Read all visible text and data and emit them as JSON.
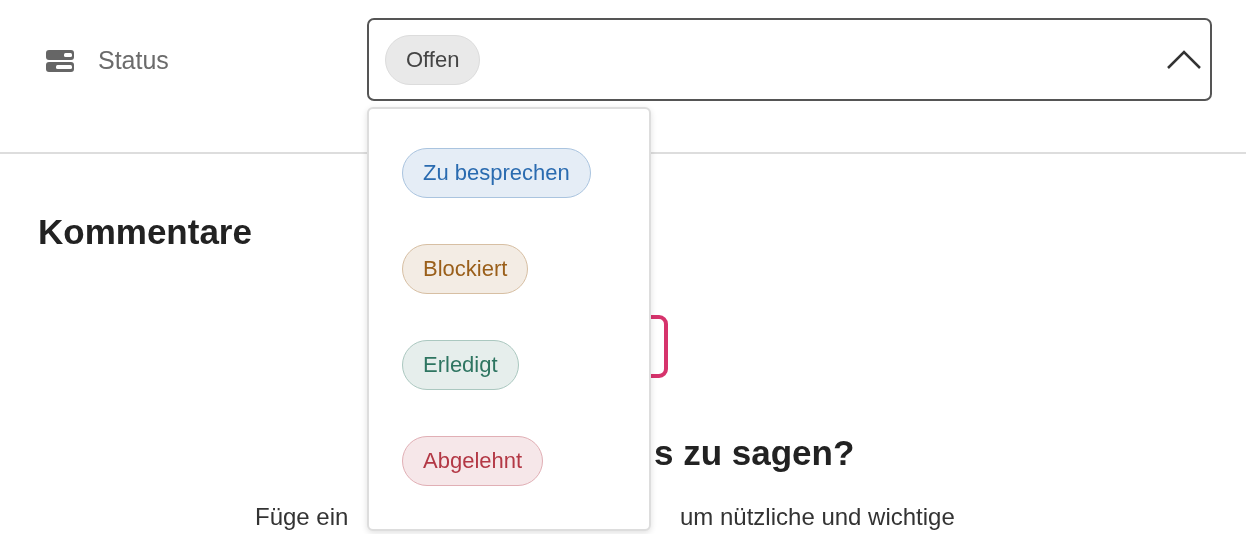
{
  "status": {
    "label": "Status",
    "value": "Offen",
    "expanded": true,
    "options": [
      {
        "label": "Zu besprechen",
        "color": "#2a6bb0"
      },
      {
        "label": "Blockiert",
        "color": "#9a5f1a"
      },
      {
        "label": "Erledigt",
        "color": "#2e7561"
      },
      {
        "label": "Abgelehnt",
        "color": "#b33845"
      }
    ]
  },
  "comments": {
    "title": "Kommentare",
    "empty_heading": "s zu sagen?",
    "empty_text_left": "Füge ein",
    "empty_text_right": "um nützliche und wichtige"
  }
}
